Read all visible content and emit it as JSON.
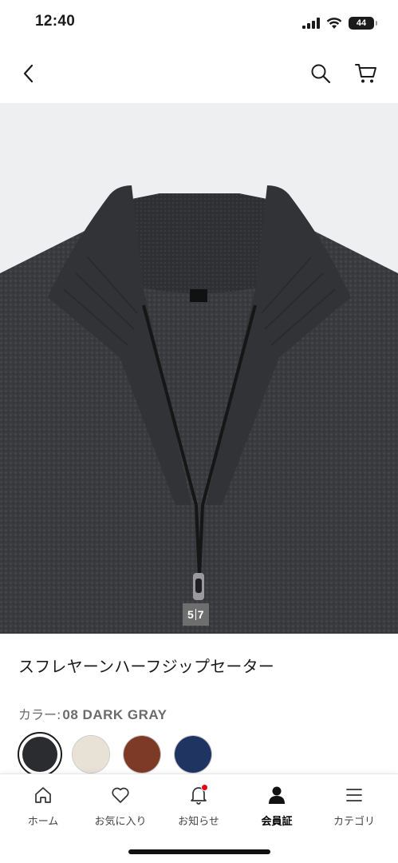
{
  "status_bar": {
    "time": "12:40",
    "battery": "44"
  },
  "product": {
    "image_page_current": "5",
    "image_page_total": "7",
    "image_progress": 0.714,
    "name": "スフレヤーンハーフジップセーター",
    "color_label": "カラー:",
    "color_value": "08 DARK GRAY",
    "swatches": [
      {
        "color": "#2b2c30",
        "selected": true
      },
      {
        "color": "#e7e1d6",
        "selected": false
      },
      {
        "color": "#7d3a26",
        "selected": false
      },
      {
        "color": "#1f3461",
        "selected": false
      }
    ]
  },
  "tab_bar": {
    "tabs": [
      {
        "label": "ホーム",
        "icon": "home-icon"
      },
      {
        "label": "お気に入り",
        "icon": "heart-icon"
      },
      {
        "label": "お知らせ",
        "icon": "bell-icon",
        "badge": true
      },
      {
        "label": "会員証",
        "icon": "member-icon",
        "active": true
      },
      {
        "label": "カテゴリ",
        "icon": "menu-icon"
      }
    ]
  },
  "colors": {
    "accent": "#e60012",
    "text": "#1b1b1b",
    "image_bg": "#eeeff1"
  }
}
